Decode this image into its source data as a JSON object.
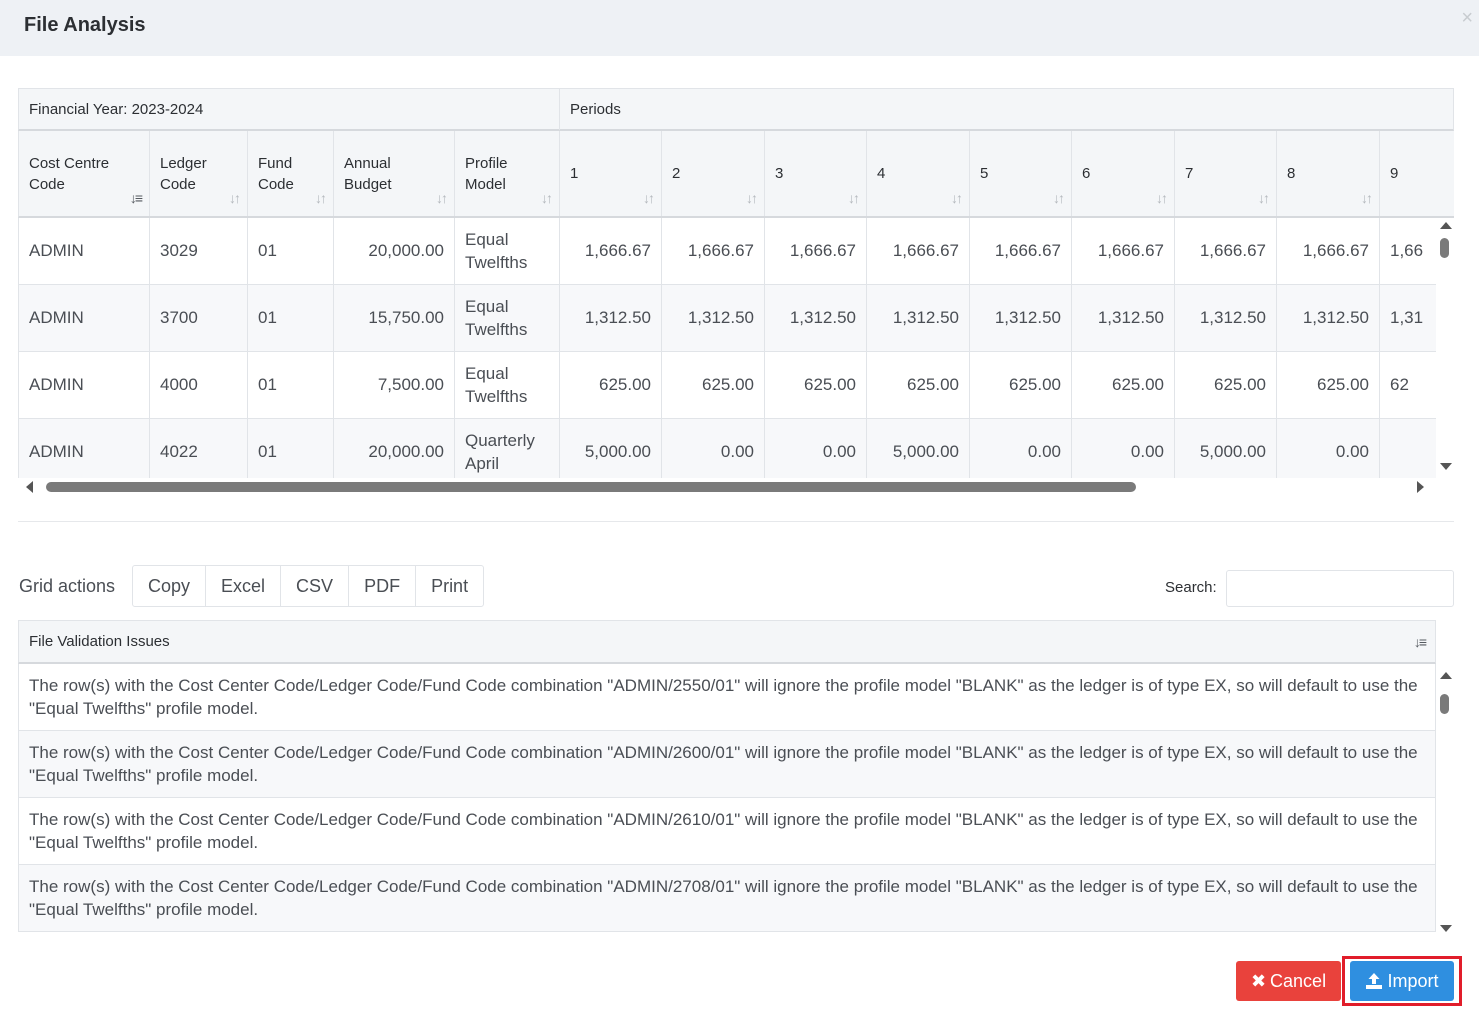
{
  "modal": {
    "title": "File Analysis",
    "close_icon": "×"
  },
  "grid": {
    "group_headers": {
      "financial_year": "Financial Year: 2023-2024",
      "periods": "Periods"
    },
    "columns": [
      {
        "label": "Cost Centre Code",
        "sort": "active"
      },
      {
        "label": "Ledger Code",
        "sort": "none"
      },
      {
        "label": "Fund Code",
        "sort": "none"
      },
      {
        "label": "Annual Budget",
        "sort": "none"
      },
      {
        "label": "Profile Model",
        "sort": "none"
      },
      {
        "label": "1",
        "sort": "none"
      },
      {
        "label": "2",
        "sort": "none"
      },
      {
        "label": "3",
        "sort": "none"
      },
      {
        "label": "4",
        "sort": "none"
      },
      {
        "label": "5",
        "sort": "none"
      },
      {
        "label": "6",
        "sort": "none"
      },
      {
        "label": "7",
        "sort": "none"
      },
      {
        "label": "8",
        "sort": "none"
      },
      {
        "label": "9",
        "sort": "none"
      }
    ],
    "rows": [
      [
        "ADMIN",
        "3029",
        "01",
        "20,000.00",
        "Equal Twelfths",
        "1,666.67",
        "1,666.67",
        "1,666.67",
        "1,666.67",
        "1,666.67",
        "1,666.67",
        "1,666.67",
        "1,666.67",
        "1,66"
      ],
      [
        "ADMIN",
        "3700",
        "01",
        "15,750.00",
        "Equal Twelfths",
        "1,312.50",
        "1,312.50",
        "1,312.50",
        "1,312.50",
        "1,312.50",
        "1,312.50",
        "1,312.50",
        "1,312.50",
        "1,31"
      ],
      [
        "ADMIN",
        "4000",
        "01",
        "7,500.00",
        "Equal Twelfths",
        "625.00",
        "625.00",
        "625.00",
        "625.00",
        "625.00",
        "625.00",
        "625.00",
        "625.00",
        "62"
      ],
      [
        "ADMIN",
        "4022",
        "01",
        "20,000.00",
        "Quarterly April",
        "5,000.00",
        "0.00",
        "0.00",
        "5,000.00",
        "0.00",
        "0.00",
        "5,000.00",
        "0.00",
        ""
      ]
    ]
  },
  "grid_actions": {
    "label": "Grid actions",
    "buttons": [
      "Copy",
      "Excel",
      "CSV",
      "PDF",
      "Print"
    ]
  },
  "search": {
    "label": "Search:",
    "value": "",
    "placeholder": ""
  },
  "validation": {
    "header": "File Validation Issues",
    "issues": [
      "The row(s) with the Cost Center Code/Ledger Code/Fund Code combination \"ADMIN/2550/01\" will ignore the profile model \"BLANK\" as the ledger is of type EX, so will default to use the \"Equal Twelfths\" profile model.",
      "The row(s) with the Cost Center Code/Ledger Code/Fund Code combination \"ADMIN/2600/01\" will ignore the profile model \"BLANK\" as the ledger is of type EX, so will default to use the \"Equal Twelfths\" profile model.",
      "The row(s) with the Cost Center Code/Ledger Code/Fund Code combination \"ADMIN/2610/01\" will ignore the profile model \"BLANK\" as the ledger is of type EX, so will default to use the \"Equal Twelfths\" profile model.",
      "The row(s) with the Cost Center Code/Ledger Code/Fund Code combination \"ADMIN/2708/01\" will ignore the profile model \"BLANK\" as the ledger is of type EX, so will default to use the \"Equal Twelfths\" profile model."
    ]
  },
  "footer": {
    "cancel_label": "Cancel",
    "import_label": "Import"
  },
  "colors": {
    "cancel": "#e9423c",
    "import": "#2f8fe0",
    "highlight": "#e11d2a",
    "header_bg": "#eef1f5"
  }
}
